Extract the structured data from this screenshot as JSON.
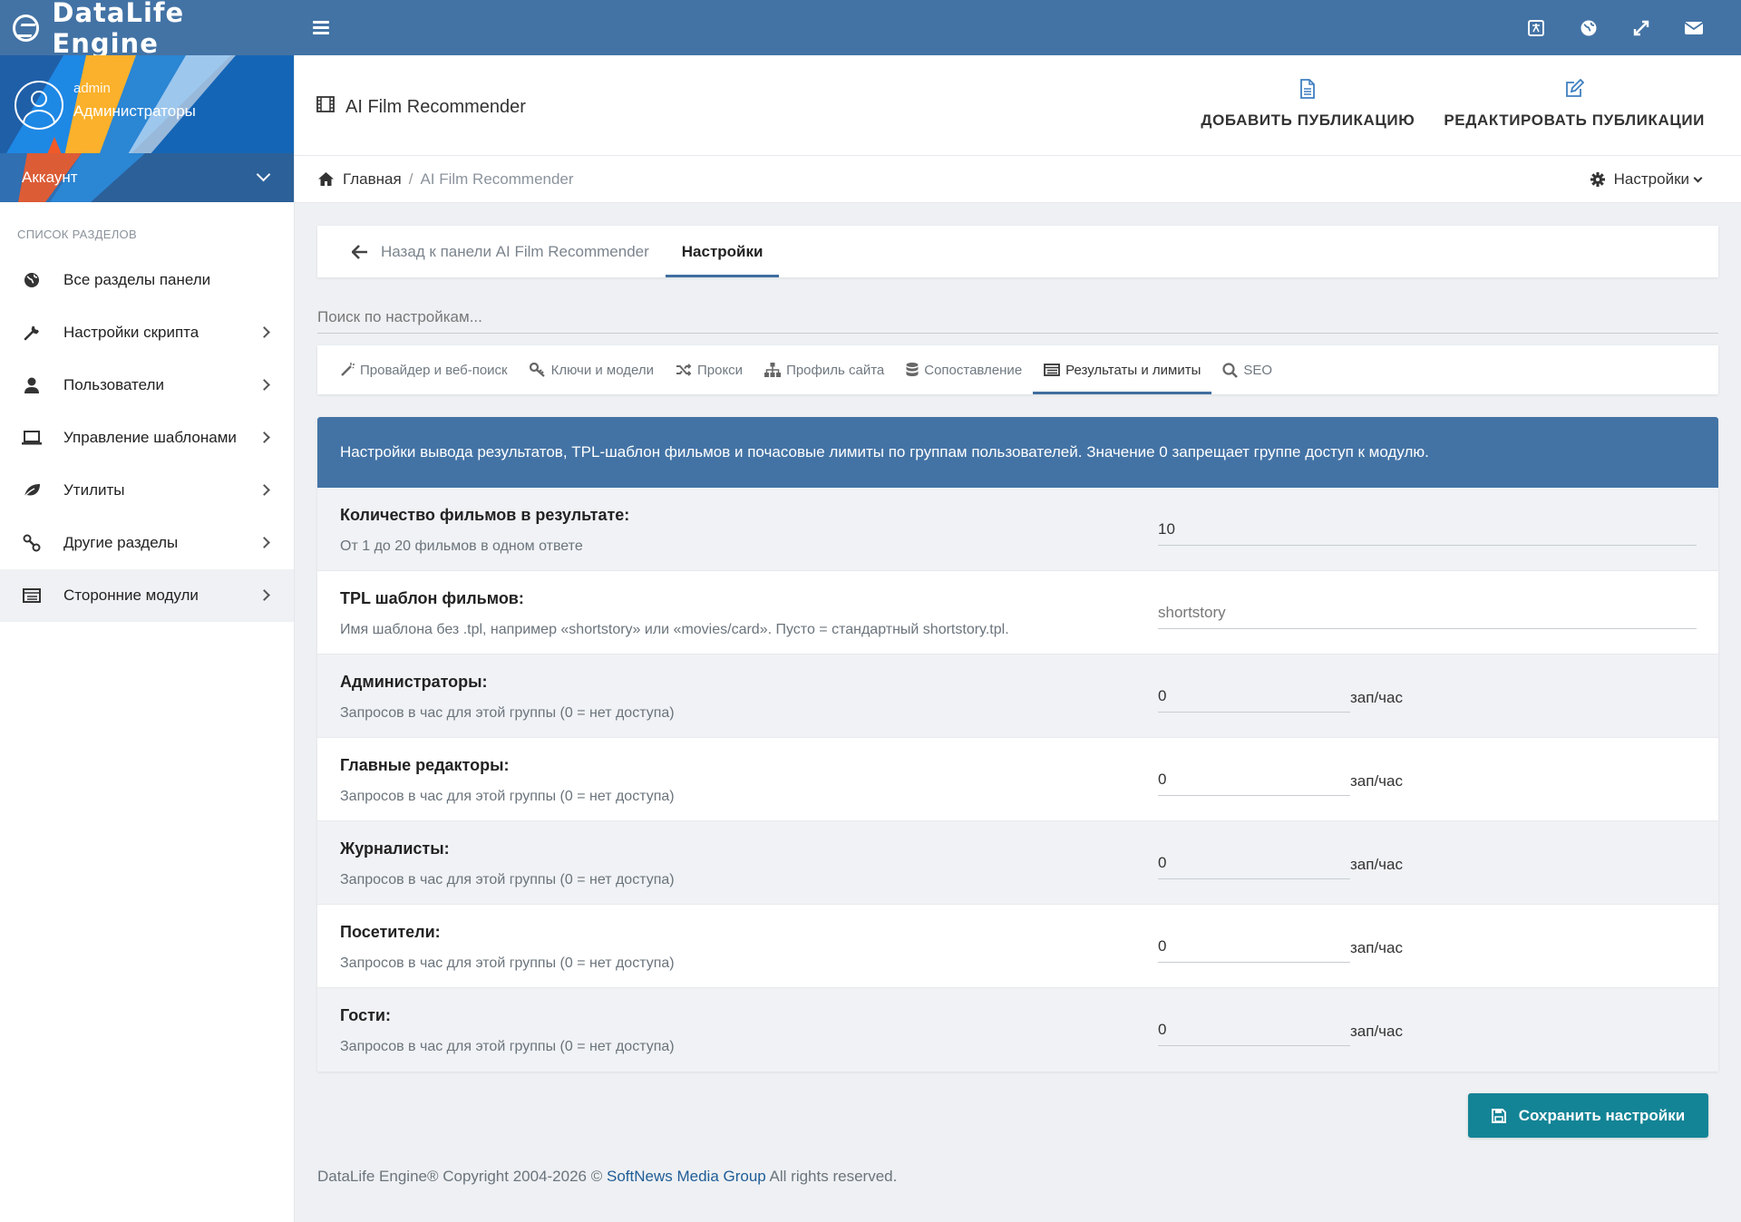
{
  "app": {
    "title": "DataLife Engine"
  },
  "sidebar": {
    "user": {
      "name": "admin",
      "group": "Администраторы"
    },
    "account_label": "Аккаунт",
    "section_title": "Список разделов",
    "items": [
      {
        "label": "Все разделы панели",
        "icon": "globe-icon"
      },
      {
        "label": "Настройки скрипта",
        "icon": "wrench-icon"
      },
      {
        "label": "Пользователи",
        "icon": "user-icon"
      },
      {
        "label": "Управление шаблонами",
        "icon": "laptop-icon"
      },
      {
        "label": "Утилиты",
        "icon": "leaf-icon"
      },
      {
        "label": "Другие разделы",
        "icon": "link-icon"
      },
      {
        "label": "Сторонние модули",
        "icon": "modules-icon"
      }
    ]
  },
  "header": {
    "title": "AI Film Recommender",
    "add_label": "Добавить публикацию",
    "edit_label": "Редактировать публикации"
  },
  "breadcrumb": {
    "home": "Главная",
    "separator": "/",
    "current": "AI Film Recommender",
    "settings_label": "Настройки"
  },
  "tabs": {
    "back_label": "Назад к панели AI Film Recommender",
    "active_label": "Настройки"
  },
  "search": {
    "placeholder": "Поиск по настройкам...",
    "value": ""
  },
  "subtabs": [
    {
      "label": "Провайдер и веб-поиск",
      "icon": "magic-wand-icon"
    },
    {
      "label": "Ключи и модели",
      "icon": "key-icon"
    },
    {
      "label": "Прокси",
      "icon": "shuffle-icon"
    },
    {
      "label": "Профиль сайта",
      "icon": "sitemap-icon"
    },
    {
      "label": "Сопоставление",
      "icon": "database-icon"
    },
    {
      "label": "Результаты и лимиты",
      "icon": "list-icon",
      "active": true
    },
    {
      "label": "SEO",
      "icon": "search-icon"
    }
  ],
  "panel": {
    "heading": "Настройки вывода результатов, TPL-шаблон фильмов и почасовые лимиты по группам пользователей. Значение 0 запрещает группе доступ к модулю.",
    "rows": [
      {
        "title": "Количество фильмов в результате:",
        "desc": "От 1 до 20 фильмов в одном ответе",
        "value": "10",
        "placeholder": "",
        "unit": ""
      },
      {
        "title": "TPL шаблон фильмов:",
        "desc": "Имя шаблона без .tpl, например «shortstory» или «movies/card». Пусто = стандартный shortstory.tpl.",
        "value": "",
        "placeholder": "shortstory",
        "unit": ""
      },
      {
        "title": "Администраторы:",
        "desc": "Запросов в час для этой группы (0 = нет доступа)",
        "value": "0",
        "placeholder": "",
        "unit": "зап/час"
      },
      {
        "title": "Главные редакторы:",
        "desc": "Запросов в час для этой группы (0 = нет доступа)",
        "value": "0",
        "placeholder": "",
        "unit": "зап/час"
      },
      {
        "title": "Журналисты:",
        "desc": "Запросов в час для этой группы (0 = нет доступа)",
        "value": "0",
        "placeholder": "",
        "unit": "зап/час"
      },
      {
        "title": "Посетители:",
        "desc": "Запросов в час для этой группы (0 = нет доступа)",
        "value": "0",
        "placeholder": "",
        "unit": "зап/час"
      },
      {
        "title": "Гости:",
        "desc": "Запросов в час для этой группы (0 = нет доступа)",
        "value": "0",
        "placeholder": "",
        "unit": "зап/час"
      }
    ]
  },
  "save_label": "Сохранить настройки",
  "footer": {
    "prefix": "DataLife Engine® Copyright 2004-2026 ©",
    "link": "SoftNews Media Group",
    "suffix": "All rights reserved."
  },
  "colors": {
    "topbar": "#4373a5",
    "accent": "#3f6e9f",
    "save": "#138496"
  }
}
